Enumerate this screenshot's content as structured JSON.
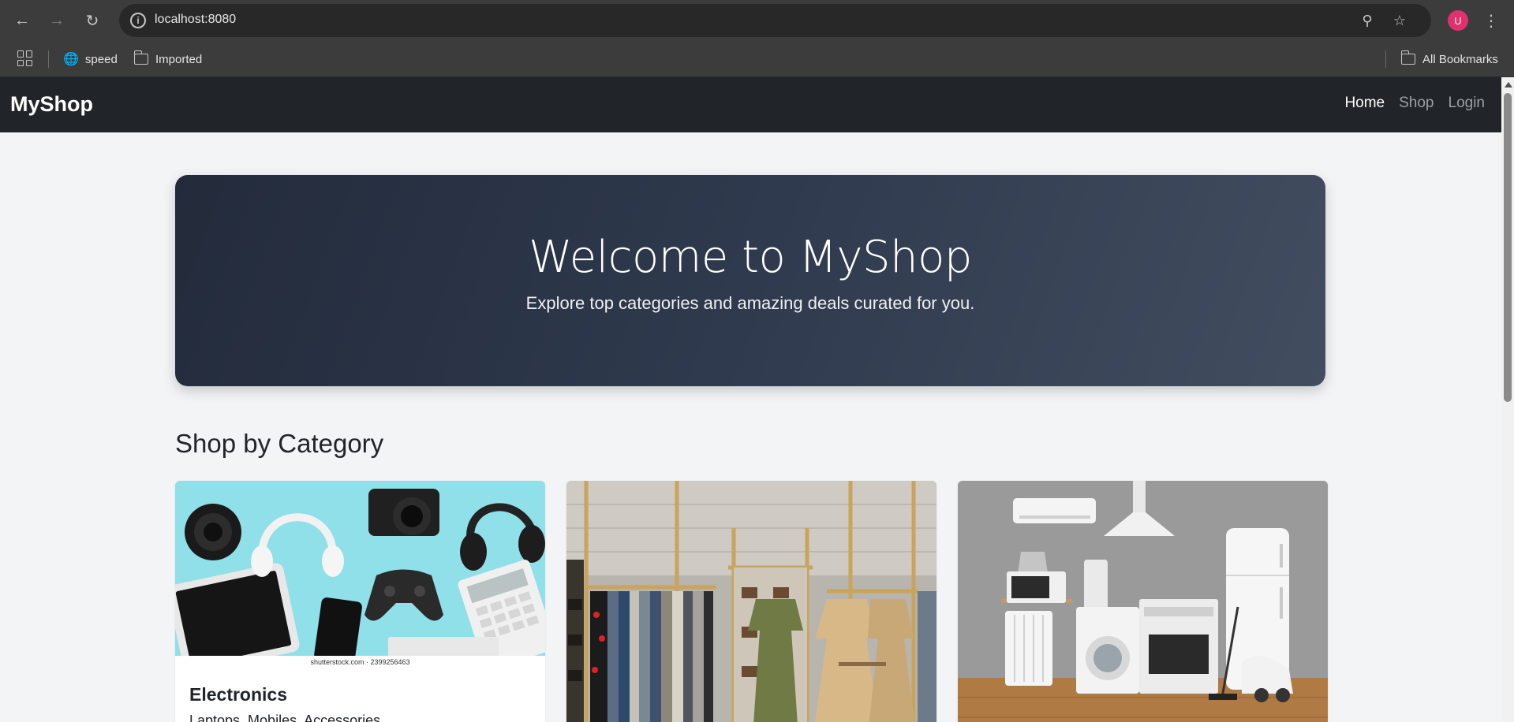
{
  "browser": {
    "url": "localhost:8080",
    "avatar_letter": "U",
    "bookmarks": [
      {
        "label": "speed"
      },
      {
        "label": "Imported"
      }
    ],
    "all_bookmarks_label": "All Bookmarks"
  },
  "navbar": {
    "brand": "MyShop",
    "links": [
      {
        "label": "Home",
        "active": true
      },
      {
        "label": "Shop",
        "active": false
      },
      {
        "label": "Login",
        "active": false
      }
    ]
  },
  "hero": {
    "title": "Welcome to MyShop",
    "subtitle": "Explore top categories and amazing deals curated for you."
  },
  "categories": {
    "heading": "Shop by Category",
    "items": [
      {
        "title": "Electronics",
        "description": "Laptops, Mobiles, Accessories",
        "image_caption": "shutterstock.com · 2399256463"
      },
      {
        "title": "",
        "description": ""
      },
      {
        "title": "",
        "description": ""
      }
    ]
  },
  "colors": {
    "navbar_bg": "#212529",
    "page_bg": "#f3f4f6",
    "hero_gradient_start": "#232b3b",
    "hero_gradient_end": "#434d60",
    "avatar": "#e0306d"
  }
}
